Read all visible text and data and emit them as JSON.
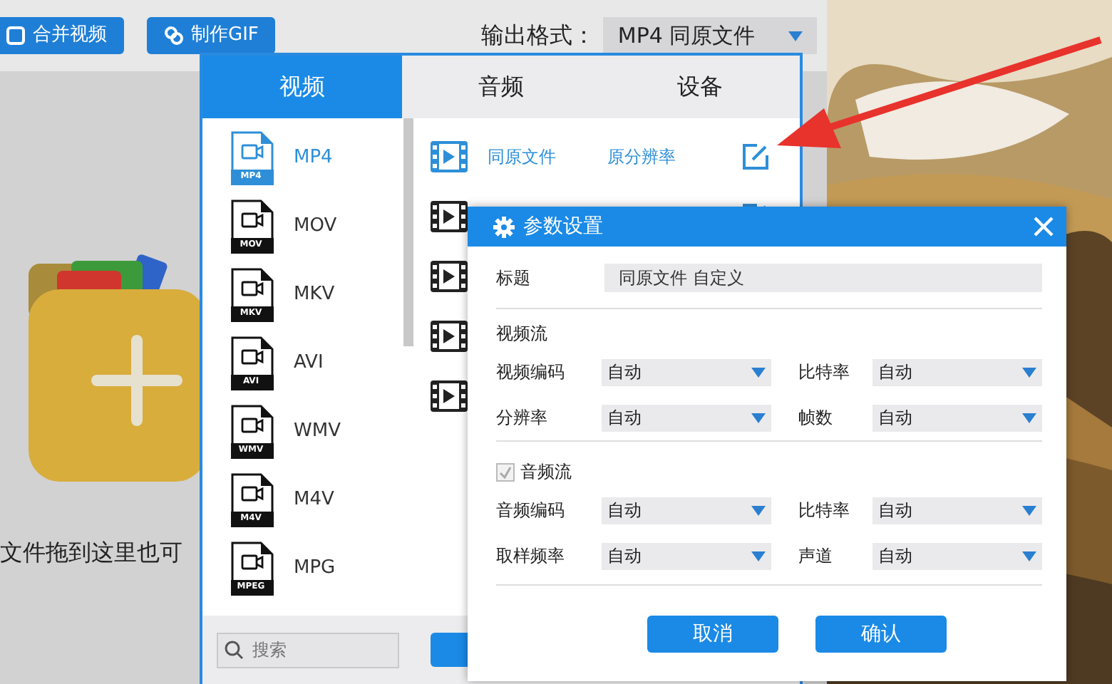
{
  "toolbar": {
    "buttons": [
      {
        "label": "合并视频",
        "kind": "merge"
      },
      {
        "label": "制作GIF",
        "kind": "gif"
      }
    ],
    "output_label": "输出格式：",
    "output_value": "MP4  同原文件"
  },
  "drop_area": {
    "text": "文件拖到这里也可"
  },
  "format_panel": {
    "tabs": [
      {
        "label": "视频",
        "selected": true
      },
      {
        "label": "音频",
        "selected": false
      },
      {
        "label": "设备",
        "selected": false
      }
    ],
    "formats": [
      {
        "label": "MP4",
        "tag": "MP4",
        "selected": true
      },
      {
        "label": "MOV",
        "tag": "MOV",
        "selected": false
      },
      {
        "label": "MKV",
        "tag": "MKV",
        "selected": false
      },
      {
        "label": "AVI",
        "tag": "AVI",
        "selected": false
      },
      {
        "label": "WMV",
        "tag": "WMV",
        "selected": false
      },
      {
        "label": "M4V",
        "tag": "M4V",
        "selected": false
      },
      {
        "label": "MPG",
        "tag": "MPEG",
        "selected": false
      }
    ],
    "presets": [
      {
        "kind": "full",
        "name": "同原文件",
        "resolution": "原分辨率",
        "selected": true
      },
      {
        "kind": "partial",
        "selected": false
      },
      {
        "kind": "icon",
        "selected": false
      },
      {
        "kind": "icon",
        "selected": false
      },
      {
        "kind": "icon",
        "selected": false
      }
    ],
    "search": {
      "placeholder": "搜索"
    }
  },
  "dialog": {
    "title": "参数设置",
    "title_label": "标题",
    "title_value": "同原文件 自定义",
    "sections": [
      {
        "kind": "heading",
        "label": "视频流",
        "rows": [
          [
            {
              "label": "视频编码",
              "value": "自动"
            },
            {
              "label": "比特率",
              "value": "自动"
            }
          ],
          [
            {
              "label": "分辨率",
              "value": "自动"
            },
            {
              "label": "帧数",
              "value": "自动"
            }
          ]
        ]
      },
      {
        "kind": "checkbox",
        "label": "音频流",
        "checked": true,
        "disabled": true,
        "rows": [
          [
            {
              "label": "音频编码",
              "value": "自动"
            },
            {
              "label": "比特率",
              "value": "自动"
            }
          ],
          [
            {
              "label": "取样频率",
              "value": "自动"
            },
            {
              "label": "声道",
              "value": "自动"
            }
          ]
        ]
      }
    ],
    "buttons": [
      "取消",
      "确认"
    ]
  }
}
